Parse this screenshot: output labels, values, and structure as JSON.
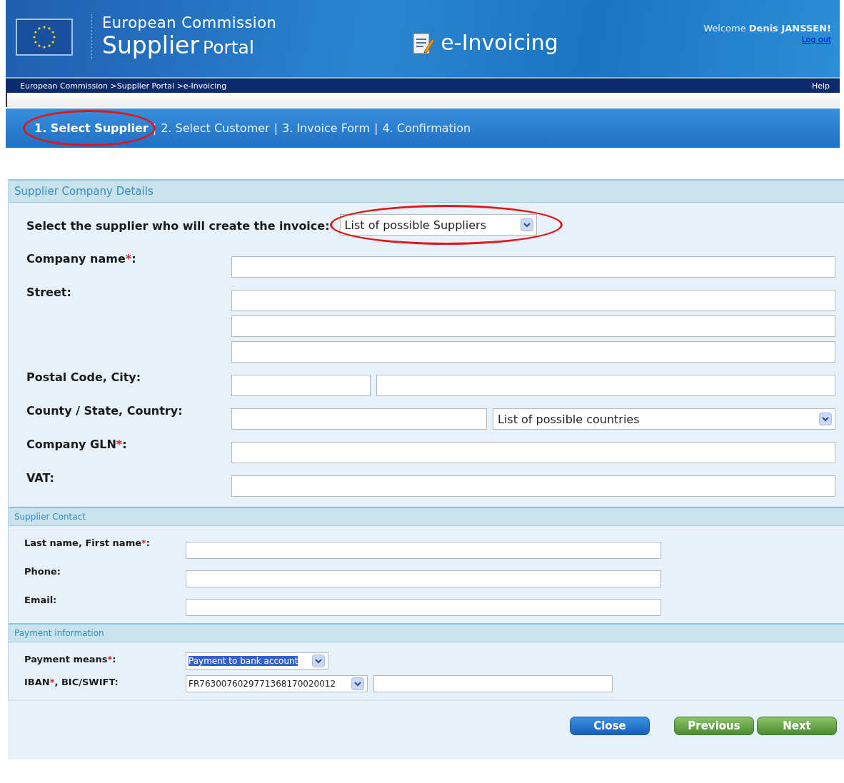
{
  "header": {
    "org": "European Commission",
    "portal_main": "Supplier",
    "portal_sub": "Portal",
    "app_title": "e-Invoicing",
    "welcome": "Welcome",
    "user": "Denis JANSSEN!",
    "logout": "Log out"
  },
  "breadcrumb": {
    "path": "European Commission >Supplier Portal >e-Invoicing",
    "help": "Help"
  },
  "steps": [
    {
      "label": "1. Select Supplier",
      "selected": true,
      "highlighted": true
    },
    {
      "label": "2. Select Customer",
      "selected": false,
      "highlighted": false
    },
    {
      "label": "3. Invoice Form",
      "selected": false,
      "highlighted": false
    },
    {
      "label": "4. Confirmation",
      "selected": false,
      "highlighted": false
    }
  ],
  "step_separator": "|",
  "sections": [
    {
      "title": "Supplier Company Details",
      "rows": [
        {
          "kind": "chooser",
          "label": [
            {
              "text": "Select the supplier who will create the invoice:",
              "kind": "plain"
            }
          ],
          "fields": [
            {
              "kind": "select",
              "value": "List of possible Suppliers",
              "highlighted": true,
              "selected": false
            }
          ]
        },
        {
          "kind": "full",
          "label": [
            {
              "text": "Company name",
              "kind": "plain"
            },
            {
              "text": "*",
              "kind": "required"
            },
            {
              "text": ":",
              "kind": "plain"
            }
          ],
          "fields": [
            {
              "kind": "text"
            }
          ]
        },
        {
          "kind": "stack",
          "label": [
            {
              "text": "Street:",
              "kind": "plain"
            }
          ],
          "fields": [
            {
              "kind": "text"
            },
            {
              "kind": "text"
            },
            {
              "kind": "text"
            }
          ]
        },
        {
          "kind": "narrow",
          "label": [
            {
              "text": "Postal Code, City:",
              "kind": "plain"
            }
          ],
          "fields": [
            {
              "kind": "text"
            },
            {
              "kind": "text"
            }
          ]
        },
        {
          "kind": "half",
          "label": [
            {
              "text": "County / State, Country:",
              "kind": "plain"
            }
          ],
          "fields": [
            {
              "kind": "text"
            },
            {
              "kind": "select",
              "value": "List of possible countries",
              "highlighted": false,
              "selected": false
            }
          ]
        },
        {
          "kind": "full",
          "label": [
            {
              "text": "Company GLN",
              "kind": "plain"
            },
            {
              "text": "*",
              "kind": "required"
            },
            {
              "text": ":",
              "kind": "plain"
            }
          ],
          "fields": [
            {
              "kind": "text"
            }
          ]
        },
        {
          "kind": "full",
          "label": [
            {
              "text": "VAT:",
              "kind": "plain"
            }
          ],
          "fields": [
            {
              "kind": "text"
            }
          ]
        }
      ]
    },
    {
      "title": "Supplier Contact",
      "rows": [
        {
          "kind": "full",
          "label": [
            {
              "text": "Last name, First name",
              "kind": "plain"
            },
            {
              "text": "*",
              "kind": "required"
            },
            {
              "text": ":",
              "kind": "plain"
            }
          ],
          "fields": [
            {
              "kind": "text"
            }
          ]
        },
        {
          "kind": "full",
          "label": [
            {
              "text": "Phone:",
              "kind": "plain"
            }
          ],
          "fields": [
            {
              "kind": "text"
            }
          ]
        },
        {
          "kind": "full",
          "label": [
            {
              "text": "Email:",
              "kind": "plain"
            }
          ],
          "fields": [
            {
              "kind": "text"
            }
          ]
        }
      ]
    },
    {
      "title": "Payment information",
      "rows": [
        {
          "kind": "compact",
          "label": [
            {
              "text": "Payment means",
              "kind": "plain"
            },
            {
              "text": "*",
              "kind": "required"
            },
            {
              "text": ":",
              "kind": "plain"
            }
          ],
          "fields": [
            {
              "kind": "select",
              "value": "Payment to bank account",
              "highlighted": false,
              "selected": true
            }
          ]
        },
        {
          "kind": "compact",
          "label": [
            {
              "text": "IBAN",
              "kind": "plain"
            },
            {
              "text": "*",
              "kind": "required"
            },
            {
              "text": ", BIC/SWIFT:",
              "kind": "plain"
            }
          ],
          "fields": [
            {
              "kind": "select",
              "value": "FR7630076029771368170020012",
              "highlighted": false,
              "selected": false
            },
            {
              "kind": "text"
            }
          ]
        }
      ]
    }
  ],
  "buttons": [
    {
      "label": "Close",
      "kind": "primary"
    },
    {
      "label": "Previous",
      "kind": "nav"
    },
    {
      "label": "Next",
      "kind": "nav"
    }
  ]
}
